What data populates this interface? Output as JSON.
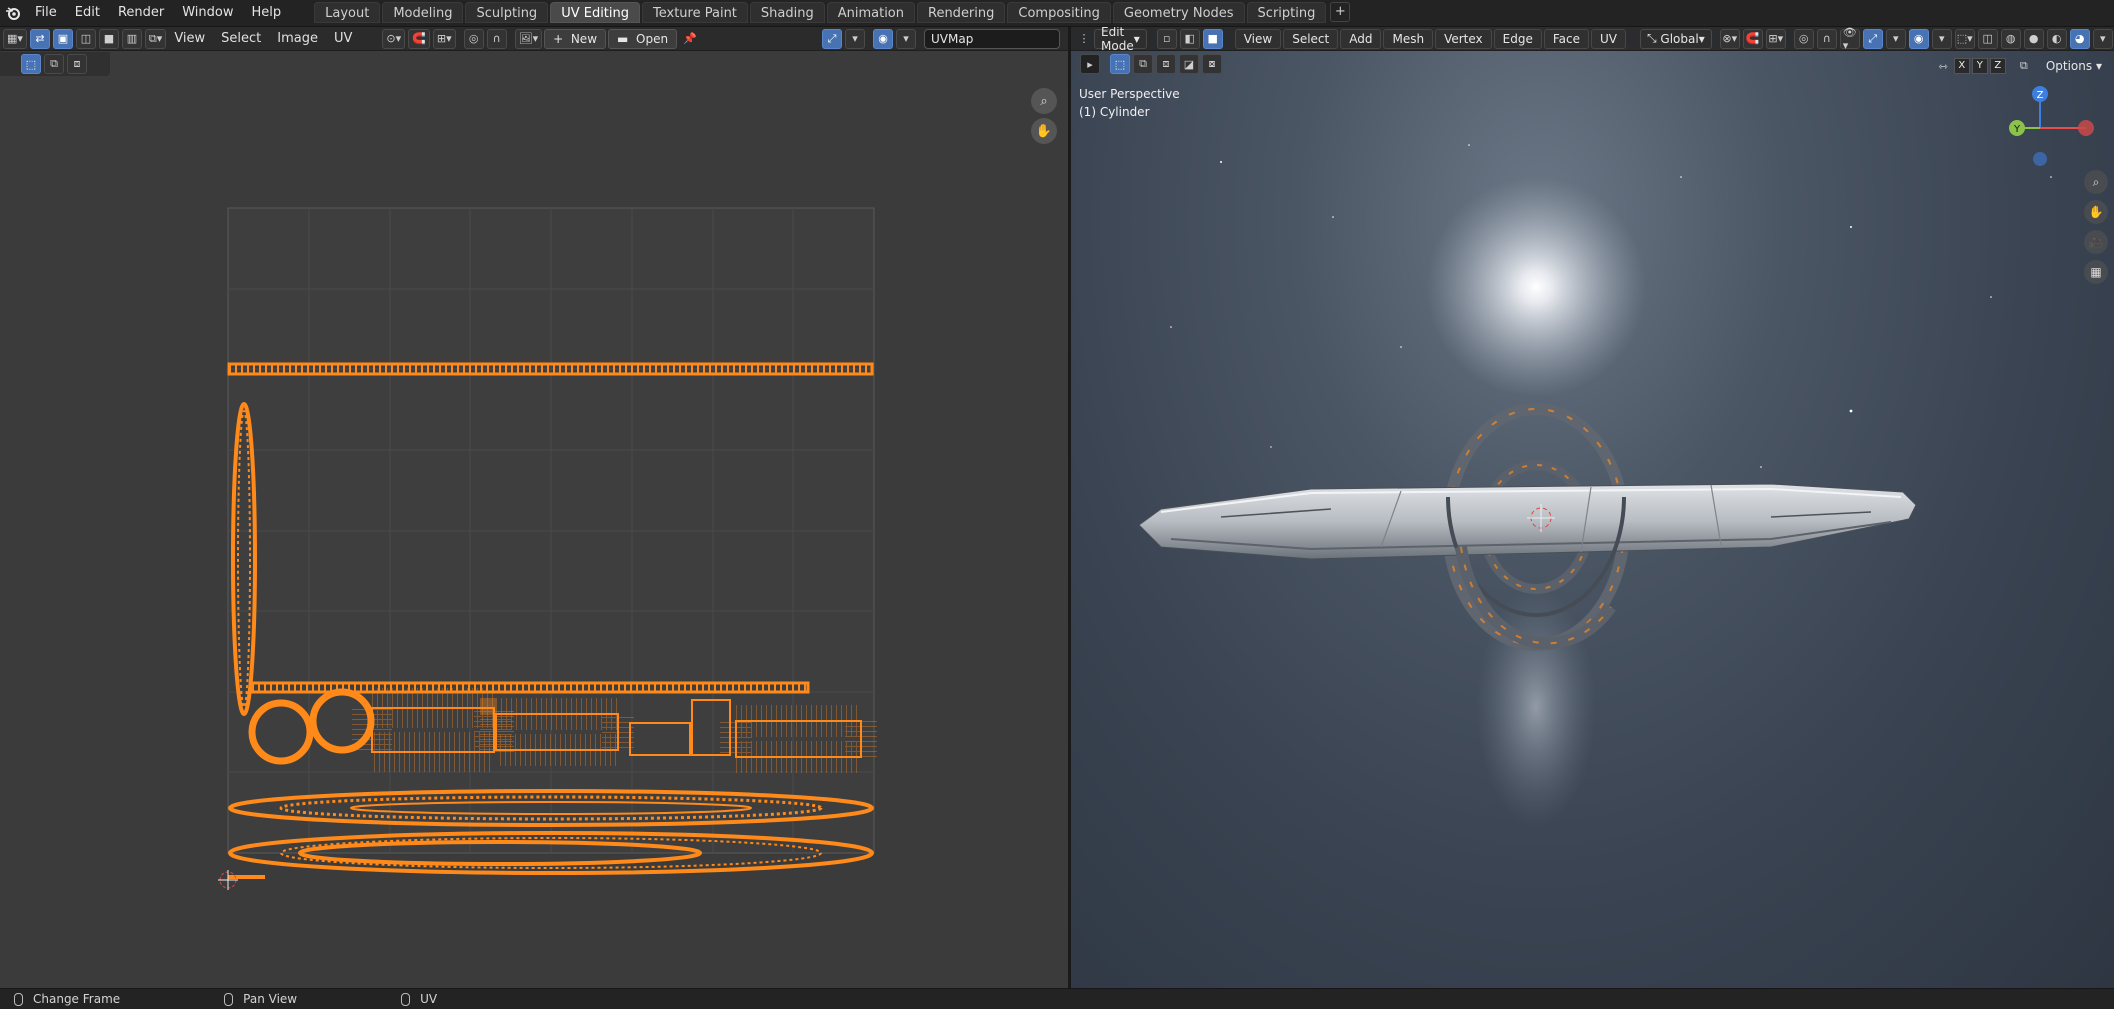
{
  "topbar": {
    "logo": "blender-logo-icon",
    "menu": [
      "File",
      "Edit",
      "Render",
      "Window",
      "Help"
    ],
    "workspaces": [
      "Layout",
      "Modeling",
      "Sculpting",
      "UV Editing",
      "Texture Paint",
      "Shading",
      "Animation",
      "Rendering",
      "Compositing",
      "Geometry Nodes",
      "Scripting"
    ],
    "active_workspace": "UV Editing",
    "add_label": "+"
  },
  "uv_editor": {
    "menu": [
      "View",
      "Select",
      "Image",
      "UV"
    ],
    "new_label": "New",
    "open_label": "Open",
    "uvmap_value": "UVMap"
  },
  "viewport": {
    "mode": "Edit Mode",
    "menu": [
      "View",
      "Select",
      "Add",
      "Mesh",
      "Vertex",
      "Edge",
      "Face",
      "UV"
    ],
    "orientation": "Global",
    "options_label": "Options",
    "perspective": "User Perspective",
    "object": "(1) Cylinder",
    "axes": [
      "X",
      "Y",
      "Z"
    ],
    "gizmo_labels": {
      "z": "Z",
      "y": "Y"
    }
  },
  "statusbar": {
    "items": [
      "Change Frame",
      "Pan View",
      "UV"
    ]
  },
  "colors": {
    "uv_orange": "#ff8a1a",
    "accent_blue": "#4772b3",
    "axis_z": "#3d7fe0",
    "axis_y": "#8bc34a",
    "axis_x": "#e84d4d"
  }
}
